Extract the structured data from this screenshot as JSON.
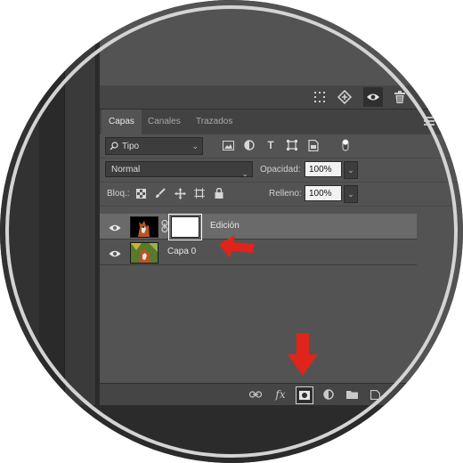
{
  "panel": {
    "tabs": [
      {
        "label": "Capas"
      },
      {
        "label": "Canales"
      },
      {
        "label": "Trazados"
      }
    ],
    "filter": {
      "kind_label": "Tipo"
    },
    "blend": {
      "mode": "Normal",
      "opacity_label": "Opacidad:",
      "opacity_value": "100%"
    },
    "lock": {
      "label": "Bloq.:",
      "fill_label": "Relleno:",
      "fill_value": "100%"
    },
    "layers": [
      {
        "name": "Edición",
        "selected": true,
        "has_mask": true
      },
      {
        "name": "Capa 0",
        "selected": false,
        "has_mask": false
      }
    ],
    "bottom": {
      "fx_label": "fx"
    }
  },
  "annotation_color": "#e0231b",
  "icons": [
    "grid-icon",
    "transform-icon",
    "eye-icon",
    "trash-icon",
    "search-icon",
    "image-filter-icon",
    "adjustment-filter-icon",
    "text-filter-icon",
    "shape-filter-icon",
    "smart-object-filter-icon",
    "filter-toggle-icon",
    "lock-transparent-icon",
    "lock-brush-icon",
    "lock-move-icon",
    "lock-artboard-icon",
    "lock-all-icon",
    "link-icon",
    "add-mask-icon",
    "adjustment-layer-icon",
    "group-folder-icon",
    "new-layer-icon",
    "menu-icon"
  ]
}
